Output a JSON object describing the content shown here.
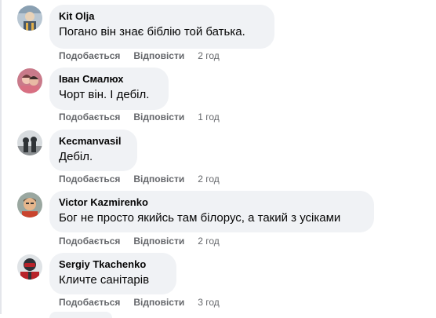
{
  "comments": [
    {
      "author": "Kit Olja",
      "text": "Погано він знає біблію той батька.",
      "like": "Подобається",
      "reply": "Відповісти",
      "time": "2 год",
      "avatar_colors": [
        "#b9c7d3",
        "#4a5a6a",
        "#e2b04a"
      ]
    },
    {
      "author": "Іван Смалюх",
      "text": "Чорт він. І дебіл.",
      "like": "Подобається",
      "reply": "Відповісти",
      "time": "1 год",
      "avatar_colors": [
        "#c97a8a",
        "#6b3b3b",
        "#f2c7b5"
      ]
    },
    {
      "author": "Kecmanvasil",
      "text": "Дебіл.",
      "like": "Подобається",
      "reply": "Відповісти",
      "time": "2 год",
      "avatar_colors": [
        "#d8dcdf",
        "#2f3336",
        "#8b8f92"
      ]
    },
    {
      "author": "Victor Kazmirenko",
      "text": "Бог не просто якийсь там білорус, а такий з усіками",
      "like": "Подобається",
      "reply": "Відповісти",
      "time": "2 год",
      "avatar_colors": [
        "#9aa7a0",
        "#c9442e",
        "#e6b68c"
      ]
    },
    {
      "author": "Sergiy Tkachenko",
      "text": "Кличте санітарів",
      "like": "Подобається",
      "reply": "Відповісти",
      "time": "3 год",
      "avatar_colors": [
        "#2e3338",
        "#b8232a",
        "#dfe3e6"
      ]
    }
  ],
  "colors": {
    "bubble": "#f0f2f5",
    "meta": "#65676b",
    "text": "#050505"
  }
}
